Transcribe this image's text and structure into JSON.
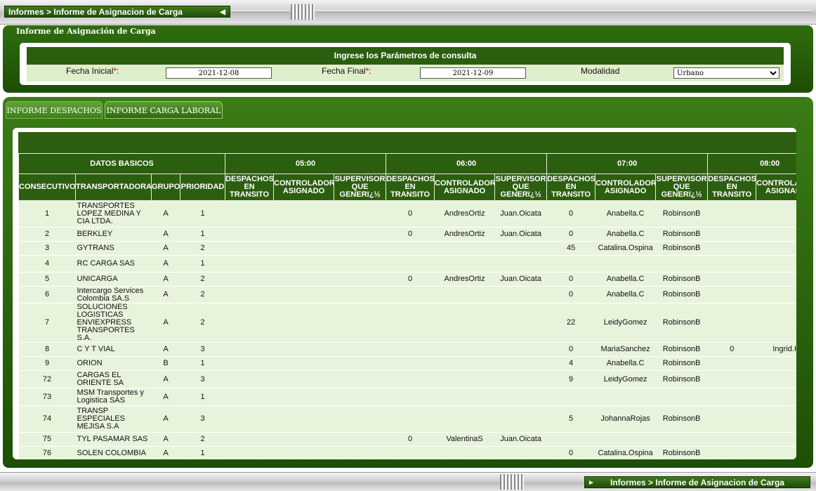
{
  "nav": {
    "breadcrumb": "Informes > Informe de Asignacion de Carga"
  },
  "header": {
    "title": "Informe de Asignación de Carga",
    "params_title": "Ingrese los Parámetros de consulta",
    "fecha_inicial_label": "Fecha Inicial",
    "fecha_inicial_value": "2021-12-08",
    "fecha_final_label": "Fecha Final",
    "fecha_final_value": "2021-12-09",
    "modalidad_label": "Modalidad",
    "modalidad_value": "Urbano",
    "required_mark": "*",
    "colon": ":"
  },
  "tabs": [
    {
      "label": "INFORME DESPACHOS"
    },
    {
      "label": "INFORME CARGA LABORAL"
    }
  ],
  "table": {
    "group_basic": "DATOS BASICOS",
    "hours": [
      "05:00",
      "06:00",
      "07:00",
      "08:00"
    ],
    "basic_columns": [
      "CONSECUTIVO",
      "TRANSPORTADORA",
      "GRUPO",
      "PRIORIDAD"
    ],
    "hour_columns": [
      "DESPACHOS EN TRANSITO",
      "CONTROLADOR ASIGNADO",
      "SUPERVISOR QUE GENERï¿½"
    ],
    "rows": [
      {
        "id": "1",
        "transportadora": "TRANSPORTES LOPEZ MEDINA Y CIA LTDA.",
        "grupo": "A",
        "prioridad": "1",
        "h05": [
          "",
          "",
          ""
        ],
        "h06": [
          "0",
          "AndresOrtiz",
          "Juan.Oicata"
        ],
        "h07": [
          "0",
          "Anabella.C",
          "RobinsonB"
        ],
        "h08": [
          "",
          ""
        ]
      },
      {
        "id": "2",
        "transportadora": "BERKLEY",
        "grupo": "A",
        "prioridad": "1",
        "h05": [
          "",
          "",
          ""
        ],
        "h06": [
          "0",
          "AndresOrtiz",
          "Juan.Oicata"
        ],
        "h07": [
          "0",
          "Anabella.C",
          "RobinsonB"
        ],
        "h08": [
          "",
          ""
        ]
      },
      {
        "id": "3",
        "transportadora": "GYTRANS",
        "grupo": "A",
        "prioridad": "2",
        "h05": [
          "",
          "",
          ""
        ],
        "h06": [
          "",
          "",
          ""
        ],
        "h07": [
          "45",
          "Catalina.Ospina",
          "RobinsonB"
        ],
        "h08": [
          "",
          ""
        ]
      },
      {
        "id": "4",
        "transportadora": "RC CARGA SAS",
        "grupo": "A",
        "prioridad": "1",
        "h05": [
          "",
          "",
          ""
        ],
        "h06": [
          "",
          "",
          ""
        ],
        "h07": [
          "",
          "",
          ""
        ],
        "h08": [
          "",
          ""
        ]
      },
      {
        "id": "5",
        "transportadora": "UNICARGA",
        "grupo": "A",
        "prioridad": "2",
        "h05": [
          "",
          "",
          ""
        ],
        "h06": [
          "0",
          "AndresOrtiz",
          "Juan.Oicata"
        ],
        "h07": [
          "0",
          "Anabella.C",
          "RobinsonB"
        ],
        "h08": [
          "",
          ""
        ]
      },
      {
        "id": "6",
        "transportadora": "Intercargo Services Colombia SA.S",
        "grupo": "A",
        "prioridad": "2",
        "h05": [
          "",
          "",
          ""
        ],
        "h06": [
          "",
          "",
          ""
        ],
        "h07": [
          "0",
          "Anabella.C",
          "RobinsonB"
        ],
        "h08": [
          "",
          ""
        ]
      },
      {
        "id": "7",
        "transportadora": "SOLUCIONES LOGISTICAS ENVIEXPRESS TRANSPORTES S.A.",
        "grupo": "A",
        "prioridad": "2",
        "h05": [
          "",
          "",
          ""
        ],
        "h06": [
          "",
          "",
          ""
        ],
        "h07": [
          "22",
          "LeidyGomez",
          "RobinsonB"
        ],
        "h08": [
          "",
          ""
        ]
      },
      {
        "id": "8",
        "transportadora": "C Y T VIAL",
        "grupo": "A",
        "prioridad": "3",
        "h05": [
          "",
          "",
          ""
        ],
        "h06": [
          "",
          "",
          ""
        ],
        "h07": [
          "0",
          "MariaSanchez",
          "RobinsonB"
        ],
        "h08": [
          "0",
          "Ingrid.H"
        ]
      },
      {
        "id": "9",
        "transportadora": "ORION",
        "grupo": "B",
        "prioridad": "1",
        "h05": [
          "",
          "",
          ""
        ],
        "h06": [
          "",
          "",
          ""
        ],
        "h07": [
          "4",
          "Anabella.C",
          "RobinsonB"
        ],
        "h08": [
          "",
          ""
        ]
      },
      {
        "id": "72",
        "transportadora": "CARGAS EL ORIENTE SA",
        "grupo": "A",
        "prioridad": "3",
        "h05": [
          "",
          "",
          ""
        ],
        "h06": [
          "",
          "",
          ""
        ],
        "h07": [
          "9",
          "LeidyGomez",
          "RobinsonB"
        ],
        "h08": [
          "",
          ""
        ]
      },
      {
        "id": "73",
        "transportadora": "MSM Transportes y Logistica SAS",
        "grupo": "A",
        "prioridad": "1",
        "h05": [
          "",
          "",
          ""
        ],
        "h06": [
          "",
          "",
          ""
        ],
        "h07": [
          "",
          "",
          ""
        ],
        "h08": [
          "",
          ""
        ]
      },
      {
        "id": "74",
        "transportadora": "TRANSP ESPECIALES MEJISA S.A",
        "grupo": "A",
        "prioridad": "3",
        "h05": [
          "",
          "",
          ""
        ],
        "h06": [
          "",
          "",
          ""
        ],
        "h07": [
          "5",
          "JohannaRojas",
          "RobinsonB"
        ],
        "h08": [
          "",
          ""
        ]
      },
      {
        "id": "75",
        "transportadora": "TYL PASAMAR SAS",
        "grupo": "A",
        "prioridad": "2",
        "h05": [
          "",
          "",
          ""
        ],
        "h06": [
          "0",
          "ValentinaS",
          "Juan.Oicata"
        ],
        "h07": [
          "",
          "",
          ""
        ],
        "h08": [
          "",
          ""
        ]
      },
      {
        "id": "76",
        "transportadora": "SOLEN COLOMBIA",
        "grupo": "A",
        "prioridad": "1",
        "h05": [
          "",
          "",
          ""
        ],
        "h06": [
          "",
          "",
          ""
        ],
        "h07": [
          "0",
          "Catalina.Ospina",
          "RobinsonB"
        ],
        "h08": [
          "",
          ""
        ]
      }
    ]
  }
}
